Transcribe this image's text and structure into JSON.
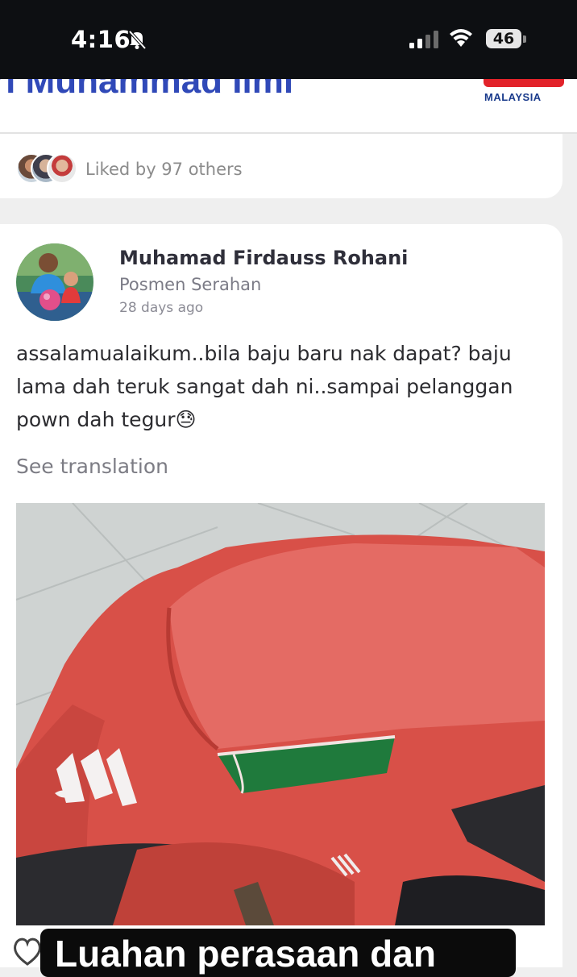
{
  "status_bar": {
    "time": "4:16",
    "battery": "46"
  },
  "header": {
    "partial_name": "ri Muhammad Ilmi",
    "logo_text": "MALAYSIA"
  },
  "likes": {
    "text": "Liked by 97 others"
  },
  "post": {
    "author_name": "Muhamad Firdauss Rohani",
    "author_role": "Posmen Serahan",
    "time_ago": "28 days ago",
    "body": "assalamualaikum..bila baju baru nak dapat? baju lama dah teruk sangat dah ni..sampai pelanggan pown dah tegur😓",
    "see_translation": "See translation"
  },
  "caption": {
    "text": "Luahan perasaan dan"
  },
  "colors": {
    "brand_blue": "#3049b8",
    "brand_red": "#e2232a",
    "shirt_red": "#e05a52"
  }
}
